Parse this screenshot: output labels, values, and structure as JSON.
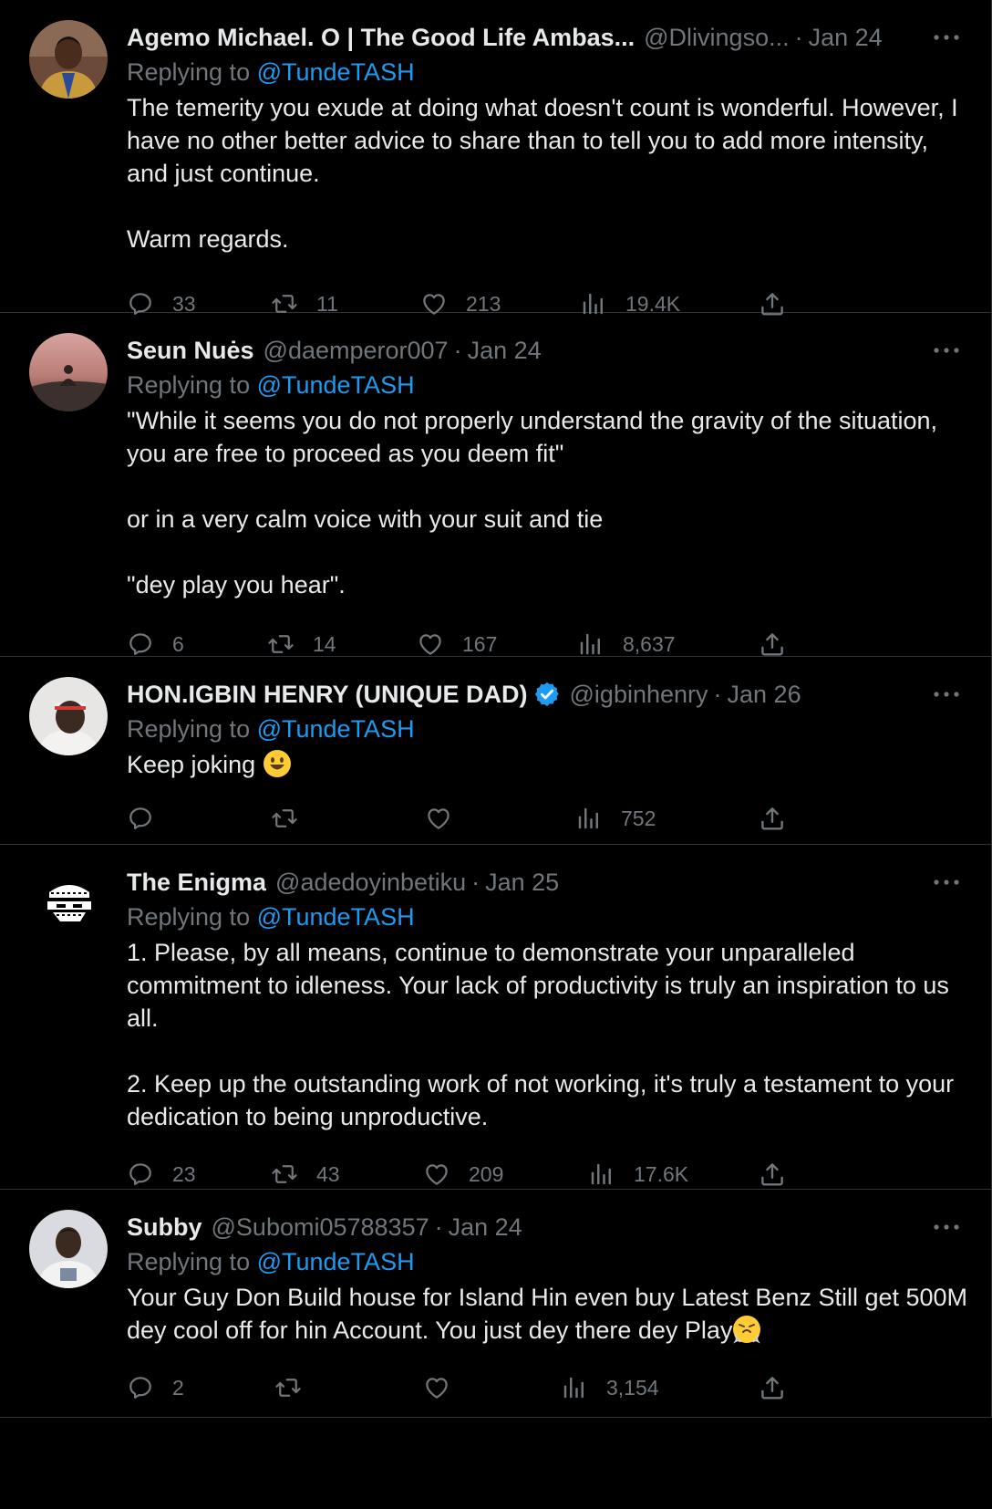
{
  "tweets": [
    {
      "name": "Agemo Michael. O | The Good Life Ambas...",
      "handle": "@Dlivingso...",
      "date": "Jan 24",
      "replying_prefix": "Replying to",
      "replying_to": "@TundeTASH",
      "paragraphs": [
        "The temerity you exude at doing what doesn't count is wonderful. However, I have no other better advice to share than to tell you to add more intensity, and just continue.",
        "Warm regards."
      ],
      "replies": "33",
      "retweets": "11",
      "likes": "213",
      "views": "19.4K"
    },
    {
      "name": "Seun Nuės",
      "handle": "@daemperor007",
      "date": "Jan 24",
      "replying_prefix": "Replying to",
      "replying_to": "@TundeTASH",
      "paragraphs": [
        "\"While it seems you do not properly understand the gravity of the situation, you are free to proceed as you deem fit\"",
        "or in a very calm voice with your suit and tie",
        "\"dey play you hear\"."
      ],
      "replies": "6",
      "retweets": "14",
      "likes": "167",
      "views": "8,637"
    },
    {
      "name": "HON.IGBIN HENRY (UNIQUE DAD)",
      "handle": "@igbinhenry",
      "date": "Jan 26",
      "replying_prefix": "Replying to",
      "replying_to": "@TundeTASH",
      "paragraphs": [
        "Keep joking"
      ],
      "emoji": "smiley",
      "replies": "",
      "retweets": "",
      "likes": "",
      "views": "752"
    },
    {
      "name": "The Enigma",
      "handle": "@adedoyinbetiku",
      "date": "Jan 25",
      "replying_prefix": "Replying to",
      "replying_to": "@TundeTASH",
      "paragraphs": [
        "1. Please, by all means, continue to demonstrate your unparalleled commitment to idleness. Your lack of productivity is truly an inspiration to us all.",
        "2. Keep up the outstanding work of not working, it's truly a testament to your dedication to being unproductive."
      ],
      "replies": "23",
      "retweets": "43",
      "likes": "209",
      "views": "17.6K"
    },
    {
      "name": "Subby",
      "handle": "@Subomi05788357",
      "date": "Jan 24",
      "replying_prefix": "Replying to",
      "replying_to": "@TundeTASH",
      "paragraphs": [
        "Your Guy Don Build house for Island Hin even buy Latest Benz Still get 500M dey cool off for hin Account. You just dey there dey Play"
      ],
      "emoji": "steam-face",
      "replies": "2",
      "retweets": "",
      "likes": "",
      "views": "3,154"
    }
  ],
  "colors": {
    "background": "#000000",
    "text": "#e7e9ea",
    "muted": "#71767b",
    "link": "#1d9bf0",
    "divider": "#2f3336"
  },
  "icons": [
    "reply-icon",
    "retweet-icon",
    "like-icon",
    "views-icon",
    "share-icon",
    "more-icon",
    "verified-badge-icon"
  ]
}
